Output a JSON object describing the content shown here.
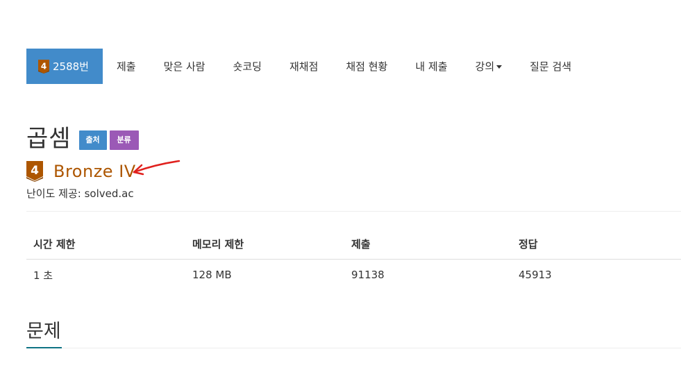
{
  "nav": {
    "problem_number": "2588번",
    "items": [
      "제출",
      "맞은 사람",
      "숏코딩",
      "재채점",
      "채점 현황",
      "내 제출",
      "강의",
      "질문 검색"
    ]
  },
  "tier_badge": {
    "number": "4",
    "color": "#ad5600"
  },
  "problem": {
    "title": "곱셈",
    "labels": {
      "source": "출처",
      "category": "분류"
    },
    "tier": "Bronze IV",
    "difficulty_credit": "난이도 제공: solved.ac"
  },
  "table": {
    "headers": [
      "시간 제한",
      "메모리 제한",
      "제출",
      "정답"
    ],
    "row": [
      "1 초",
      "128 MB",
      "91138",
      "45913"
    ]
  },
  "section": {
    "title": "문제"
  },
  "colors": {
    "nav_active": "#428bca",
    "label_source": "#428bca",
    "label_category": "#9b59b6",
    "tier_text": "#ad5600",
    "section_accent": "#0f7384",
    "annotation_arrow": "#e0201d"
  }
}
